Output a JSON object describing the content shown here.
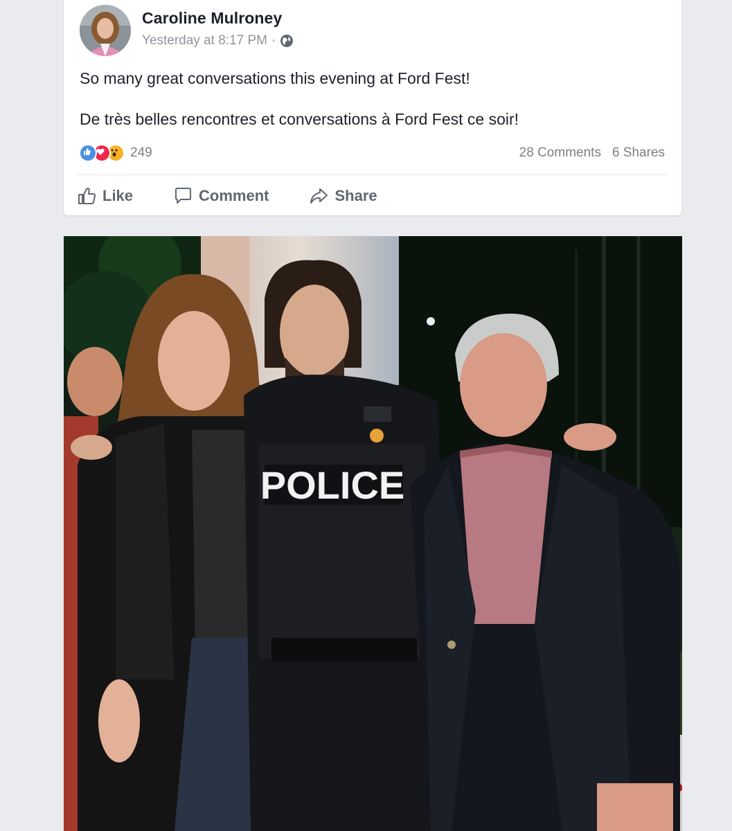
{
  "post": {
    "author": "Caroline Mulroney",
    "timestamp": "Yesterday at 8:17 PM",
    "separator": "·",
    "privacy_icon": "globe-icon",
    "text_en": "So many great conversations this evening at Ford Fest!",
    "text_fr": "De très belles rencontres et conversations à Ford Fest ce soir!",
    "reactions": {
      "icons": [
        "like-reaction-icon",
        "love-reaction-icon",
        "wow-reaction-icon"
      ],
      "count": "249"
    },
    "comments_count": "28 Comments",
    "shares_count": "6 Shares"
  },
  "actions": {
    "like_label": "Like",
    "comment_label": "Comment",
    "share_label": "Share"
  },
  "photo": {
    "vest_text": "POLICE"
  },
  "colors": {
    "background": "#e9ebee",
    "card": "#ffffff",
    "text_primary": "#1d2129",
    "text_secondary": "#90949c",
    "action_text": "#606770",
    "like_blue": "#4a90e2",
    "love_red": "#f0284a",
    "wow_yellow": "#f7b125"
  }
}
